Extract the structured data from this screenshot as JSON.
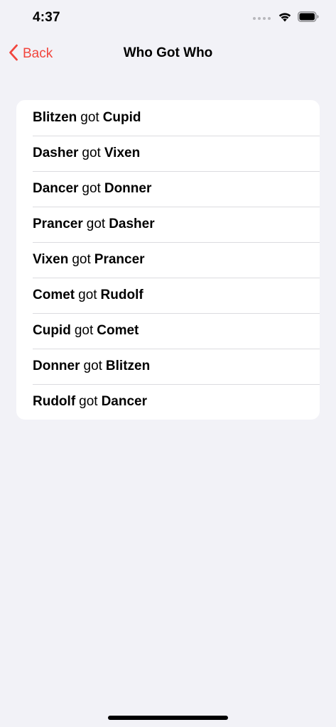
{
  "status_bar": {
    "time": "4:37",
    "icons": [
      "signal-icon",
      "wifi-icon",
      "battery-icon"
    ]
  },
  "nav": {
    "back_label": "Back",
    "title": "Who Got Who"
  },
  "colors": {
    "accent": "#f2453d",
    "background": "#f2f2f7",
    "card": "#ffffff"
  },
  "pairings": [
    {
      "giver": "Blitzen",
      "connector": "got",
      "receiver": "Cupid"
    },
    {
      "giver": "Dasher",
      "connector": "got",
      "receiver": "Vixen"
    },
    {
      "giver": "Dancer",
      "connector": "got",
      "receiver": "Donner"
    },
    {
      "giver": "Prancer",
      "connector": "got",
      "receiver": "Dasher"
    },
    {
      "giver": "Vixen",
      "connector": "got",
      "receiver": "Prancer"
    },
    {
      "giver": "Comet",
      "connector": "got",
      "receiver": "Rudolf"
    },
    {
      "giver": "Cupid",
      "connector": "got",
      "receiver": "Comet"
    },
    {
      "giver": "Donner",
      "connector": "got",
      "receiver": "Blitzen"
    },
    {
      "giver": "Rudolf",
      "connector": "got",
      "receiver": "Dancer"
    }
  ]
}
